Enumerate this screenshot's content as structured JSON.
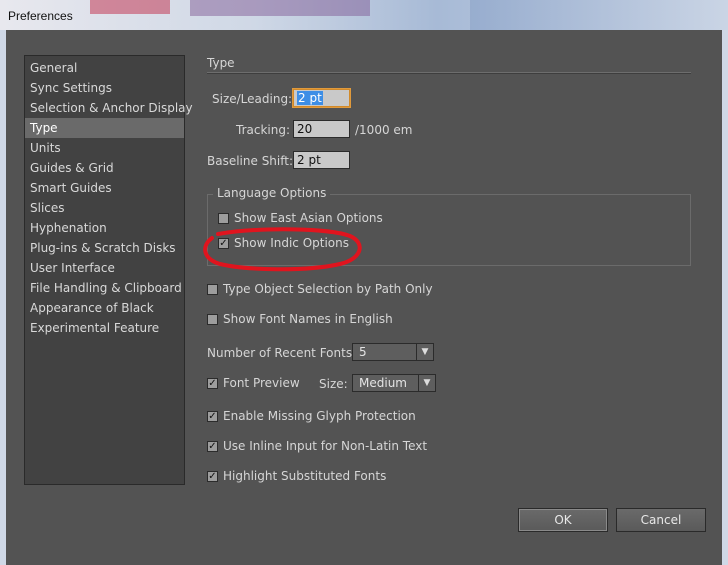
{
  "window": {
    "title": "Preferences"
  },
  "sidebar": {
    "items": [
      {
        "label": "General"
      },
      {
        "label": "Sync Settings"
      },
      {
        "label": "Selection & Anchor Display"
      },
      {
        "label": "Type",
        "selected": true
      },
      {
        "label": "Units"
      },
      {
        "label": "Guides & Grid"
      },
      {
        "label": "Smart Guides"
      },
      {
        "label": "Slices"
      },
      {
        "label": "Hyphenation"
      },
      {
        "label": "Plug-ins & Scratch Disks"
      },
      {
        "label": "User Interface"
      },
      {
        "label": "File Handling & Clipboard"
      },
      {
        "label": "Appearance of Black"
      },
      {
        "label": "Experimental Feature"
      }
    ]
  },
  "panel": {
    "title": "Type",
    "size_leading": {
      "label": "Size/Leading:",
      "value": "2 pt"
    },
    "tracking": {
      "label": "Tracking:",
      "value": "20",
      "unit": "/1000 em"
    },
    "baseline_shift": {
      "label": "Baseline Shift:",
      "value": "2 pt"
    },
    "language_options": {
      "label": "Language Options",
      "east_asian": {
        "label": "Show East Asian Options",
        "checked": false
      },
      "indic": {
        "label": "Show Indic Options",
        "checked": true
      }
    },
    "type_object_selection": {
      "label": "Type Object Selection by Path Only",
      "checked": false
    },
    "font_names_english": {
      "label": "Show Font Names in English",
      "checked": false
    },
    "recent_fonts": {
      "label": "Number of Recent Fonts:",
      "value": "5"
    },
    "font_preview": {
      "label": "Font Preview",
      "checked": true,
      "size_label": "Size:",
      "size_value": "Medium"
    },
    "missing_glyph": {
      "label": "Enable Missing Glyph Protection",
      "checked": true
    },
    "inline_input": {
      "label": "Use Inline Input for Non-Latin Text",
      "checked": true
    },
    "highlight_substituted": {
      "label": "Highlight Substituted Fonts",
      "checked": true
    }
  },
  "buttons": {
    "ok": "OK",
    "cancel": "Cancel"
  },
  "colors": {
    "annotation": "#e0141e",
    "selection": "#6a6a6a",
    "focus": "#d28a2a"
  }
}
